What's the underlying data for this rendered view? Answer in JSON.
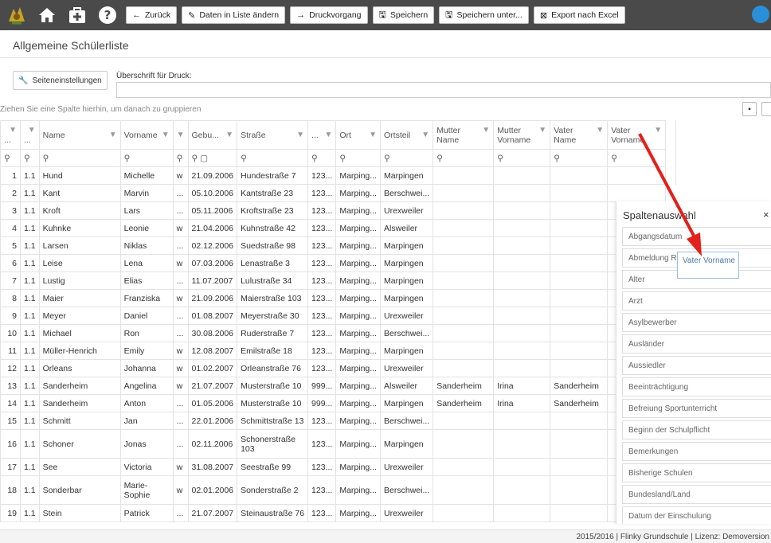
{
  "toolbar": {
    "buttons": [
      {
        "icon": "←",
        "label": "Zurück"
      },
      {
        "icon": "✎",
        "label": "Daten in Liste ändern"
      },
      {
        "icon": "→",
        "label": "Druckvorgang"
      },
      {
        "icon": "🖫",
        "label": "Speichern"
      },
      {
        "icon": "🖫",
        "label": "Speichern unter..."
      },
      {
        "icon": "⊠",
        "label": "Export nach Excel"
      }
    ]
  },
  "page": {
    "title": "Allgemeine Schülerliste",
    "settings_label": "Seiteneinstellungen",
    "print_heading_label": "Überschrift für Druck:",
    "print_heading_value": "",
    "group_hint": "Ziehen Sie eine Spalte hierhin, um danach zu gruppieren"
  },
  "columns": [
    "...",
    "...",
    "Name",
    "Vorname",
    "",
    "Gebu...",
    "Straße",
    "...",
    "Ort",
    "Ortsteil",
    "Mutter Name",
    "Mutter Vorname",
    "Vater Name",
    "Vater Vorname"
  ],
  "rows": [
    [
      "1",
      "1.1",
      "Hund",
      "Michelle",
      "w",
      "21.09.2006",
      "Hundestraße 7",
      "123...",
      "Marping...",
      "Marpingen",
      "",
      "",
      "",
      ""
    ],
    [
      "2",
      "1.1",
      "Kant",
      "Marvin",
      "...",
      "05.10.2006",
      "Kantstraße 23",
      "123...",
      "Marping...",
      "Berschwei...",
      "",
      "",
      "",
      ""
    ],
    [
      "3",
      "1.1",
      "Kroft",
      "Lars",
      "...",
      "05.11.2006",
      "Kroftstraße 23",
      "123...",
      "Marping...",
      "Urexweiler",
      "",
      "",
      "",
      ""
    ],
    [
      "4",
      "1.1",
      "Kuhnke",
      "Leonie",
      "w",
      "21.04.2006",
      "Kuhnstraße 42",
      "123...",
      "Marping...",
      "Alsweiler",
      "",
      "",
      "",
      ""
    ],
    [
      "5",
      "1.1",
      "Larsen",
      "Niklas",
      "...",
      "02.12.2006",
      "Suedstraße 98",
      "123...",
      "Marping...",
      "Marpingen",
      "",
      "",
      "",
      ""
    ],
    [
      "6",
      "1.1",
      "Leise",
      "Lena",
      "w",
      "07.03.2006",
      "Lenastraße 3",
      "123...",
      "Marping...",
      "Marpingen",
      "",
      "",
      "",
      ""
    ],
    [
      "7",
      "1.1",
      "Lustig",
      "Elias",
      "...",
      "11.07.2007",
      "Lulustraße 34",
      "123...",
      "Marping...",
      "Marpingen",
      "",
      "",
      "",
      ""
    ],
    [
      "8",
      "1.1",
      "Maier",
      "Franziska",
      "w",
      "21.09.2006",
      "Maierstraße 103",
      "123...",
      "Marping...",
      "Marpingen",
      "",
      "",
      "",
      ""
    ],
    [
      "9",
      "1.1",
      "Meyer",
      "Daniel",
      "...",
      "01.08.2007",
      "Meyerstraße 30",
      "123...",
      "Marping...",
      "Urexweiler",
      "",
      "",
      "",
      ""
    ],
    [
      "10",
      "1.1",
      "Michael",
      "Ron",
      "...",
      "30.08.2006",
      "Ruderstraße 7",
      "123...",
      "Marping...",
      "Berschwei...",
      "",
      "",
      "",
      ""
    ],
    [
      "11",
      "1.1",
      "Müller-Henrich",
      "Emily",
      "w",
      "12.08.2007",
      "Emilstraße 18",
      "123...",
      "Marping...",
      "Marpingen",
      "",
      "",
      "",
      ""
    ],
    [
      "12",
      "1.1",
      "Orleans",
      "Johanna",
      "w",
      "01.02.2007",
      "Orleanstraße 76",
      "123...",
      "Marping...",
      "Urexweiler",
      "",
      "",
      "",
      ""
    ],
    [
      "13",
      "1.1",
      "Sanderheim",
      "Angelina",
      "w",
      "21.07.2007",
      "Musterstraße 10",
      "999...",
      "Marping...",
      "Alsweiler",
      "Sanderheim",
      "Irina",
      "Sanderheim",
      ""
    ],
    [
      "14",
      "1.1",
      "Sanderheim",
      "Anton",
      "...",
      "01.05.2006",
      "Musterstraße 10",
      "999...",
      "Marping...",
      "Marpingen",
      "Sanderheim",
      "Irina",
      "Sanderheim",
      ""
    ],
    [
      "15",
      "1.1",
      "Schmitt",
      "Jan",
      "...",
      "22.01.2006",
      "Schmittstraße 13",
      "123...",
      "Marping...",
      "Berschwei...",
      "",
      "",
      "",
      ""
    ],
    [
      "16",
      "1.1",
      "Schoner",
      "Jonas",
      "...",
      "02.11.2006",
      "Schonerstraße 103",
      "123...",
      "Marping...",
      "Marpingen",
      "",
      "",
      "",
      ""
    ],
    [
      "17",
      "1.1",
      "See",
      "Victoria",
      "w",
      "31.08.2007",
      "Seestraße 99",
      "123...",
      "Marping...",
      "Urexweiler",
      "",
      "",
      "",
      ""
    ],
    [
      "18",
      "1.1",
      "Sonderbar",
      "Marie-Sophie",
      "w",
      "02.01.2006",
      "Sonderstraße 2",
      "123...",
      "Marping...",
      "Berschwei...",
      "",
      "",
      "",
      ""
    ],
    [
      "19",
      "1.1",
      "Stein",
      "Patrick",
      "...",
      "21.07.2007",
      "Steinaustraße 76",
      "123...",
      "Marping...",
      "Urexweiler",
      "",
      "",
      "",
      ""
    ]
  ],
  "column_chooser": {
    "title": "Spaltenauswahl",
    "close": "×",
    "items": [
      "Abgangsdatum",
      "Abmeldung Re",
      "Alter",
      "Arzt",
      "Asylbewerber",
      "Ausländer",
      "Aussiedler",
      "Beeinträchtigung",
      "Befreiung Sportunterricht",
      "Beginn der Schulpflicht",
      "Bemerkungen",
      "Bisherige Schulen",
      "Bundesland/Land",
      "Datum der Einschulung"
    ],
    "drag_ghost": "Vater Vorname"
  },
  "footer": "2015/2016 | Flinky Grundschule | Lizenz: Demoversion",
  "colors": {
    "toolbar_bg": "#4a4a4a",
    "arrow": "#e3201b",
    "ghost_border": "#9bbbe0"
  }
}
